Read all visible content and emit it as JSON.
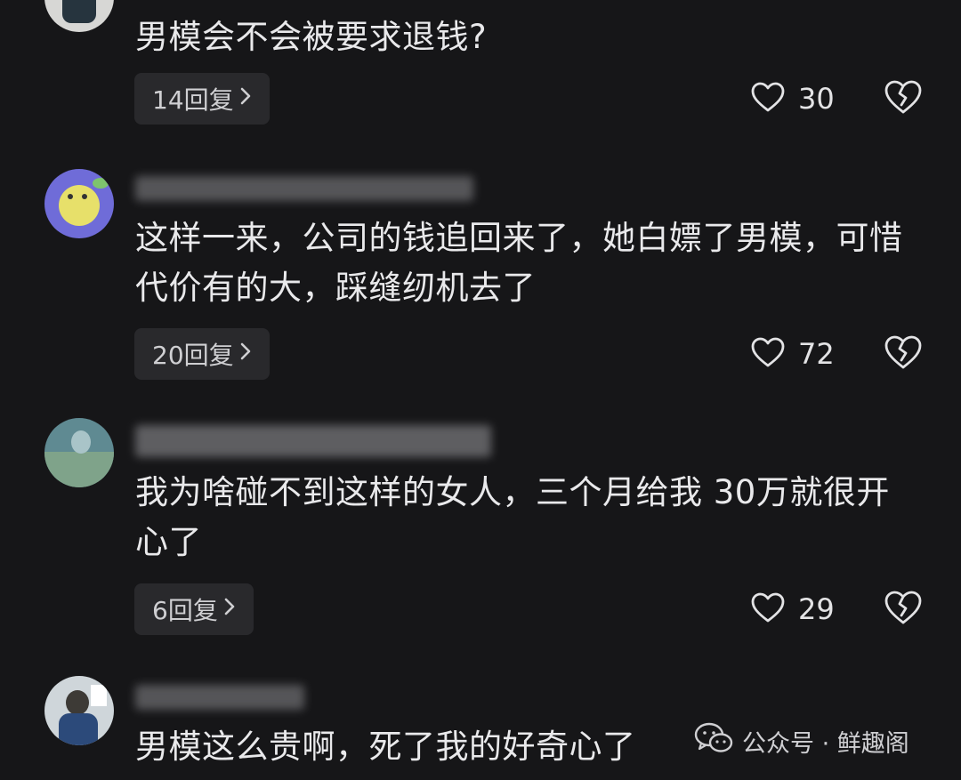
{
  "comments": [
    {
      "text": "男模会不会被要求退钱?",
      "reply_label": "14回复",
      "likes": "30"
    },
    {
      "text": "这样一来，公司的钱追回来了，她白嫖了男模，可惜代价有的大，踩缝纫机去了",
      "reply_label": "20回复",
      "likes": "72"
    },
    {
      "text": "我为啥碰不到这样的女人，三个月给我 30万就很开心了",
      "reply_label": "6回复",
      "likes": "29"
    },
    {
      "text": "男模这么贵啊，死了我的好奇心了"
    }
  ],
  "icons": {
    "reply_chevron": "chevron-right-icon",
    "like": "heart-icon",
    "dislike": "broken-heart-icon",
    "watermark": "wechat-icon"
  },
  "watermark": {
    "label": "公众号 · 鲜趣阁"
  },
  "colors": {
    "background": "#161618",
    "button_bg": "#29292c",
    "text": "#e9e9eb"
  }
}
